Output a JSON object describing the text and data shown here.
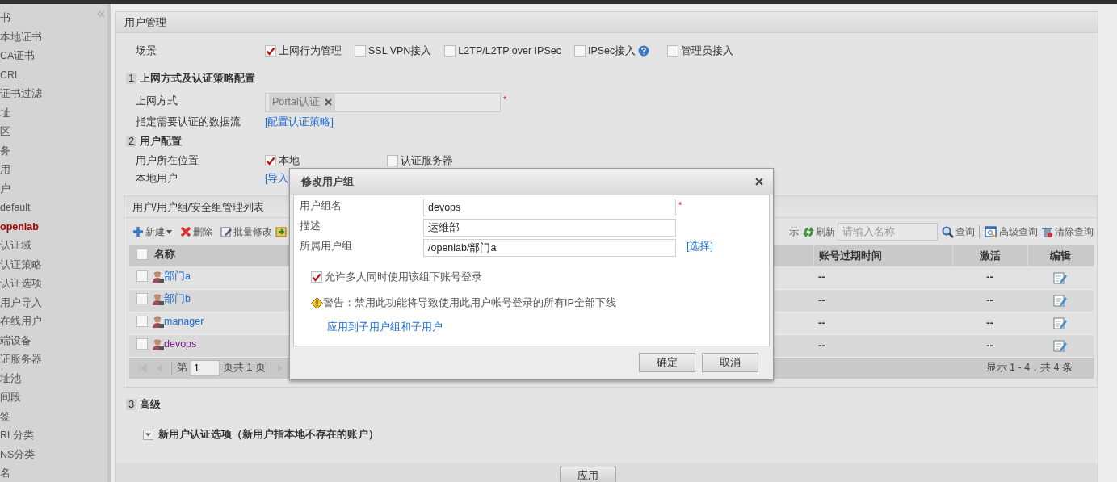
{
  "sidebar": {
    "items": [
      {
        "label": "书",
        "selected": false
      },
      {
        "label": "本地证书",
        "selected": false
      },
      {
        "label": "CA证书",
        "selected": false
      },
      {
        "label": "CRL",
        "selected": false
      },
      {
        "label": "证书过滤",
        "selected": false
      },
      {
        "label": "址",
        "selected": false
      },
      {
        "label": "区",
        "selected": false
      },
      {
        "label": "务",
        "selected": false
      },
      {
        "label": "用",
        "selected": false
      },
      {
        "label": "户",
        "selected": false
      },
      {
        "label": "default",
        "selected": false
      },
      {
        "label": "openlab",
        "selected": true
      },
      {
        "label": "认证域",
        "selected": false
      },
      {
        "label": "认证策略",
        "selected": false
      },
      {
        "label": "认证选项",
        "selected": false
      },
      {
        "label": "用户导入",
        "selected": false
      },
      {
        "label": "在线用户",
        "selected": false
      },
      {
        "label": "端设备",
        "selected": false
      },
      {
        "label": "证服务器",
        "selected": false
      },
      {
        "label": "址池",
        "selected": false
      },
      {
        "label": "间段",
        "selected": false
      },
      {
        "label": "签",
        "selected": false
      },
      {
        "label": "RL分类",
        "selected": false
      },
      {
        "label": "NS分类",
        "selected": false
      },
      {
        "label": "名",
        "selected": false
      }
    ]
  },
  "panel": {
    "title": "用户管理",
    "scene": {
      "label": "场景",
      "options": [
        {
          "label": "上网行为管理",
          "checked": true,
          "help": false
        },
        {
          "label": "SSL VPN接入",
          "checked": false,
          "help": false
        },
        {
          "label": "L2TP/L2TP over IPSec",
          "checked": false,
          "help": false
        },
        {
          "label": "IPSec接入",
          "checked": false,
          "help": true
        },
        {
          "label": "管理员接入",
          "checked": false,
          "help": false
        }
      ]
    },
    "section_1": {
      "number": "1",
      "title": "上网方式及认证策略配置",
      "access_mode": {
        "label": "上网方式",
        "tags": [
          "Portal认证"
        ],
        "required_mark": "*"
      },
      "data_flow": {
        "label": "指定需要认证的数据流",
        "link": "[配置认证策略]"
      }
    },
    "section_2": {
      "number": "2",
      "title": "用户配置",
      "location": {
        "label": "用户所在位置",
        "options": [
          {
            "label": "本地",
            "checked": true
          },
          {
            "label": "认证服务器",
            "checked": false
          }
        ]
      },
      "local_users": {
        "label": "本地用户",
        "link": "[导入"
      }
    },
    "user_list": {
      "title": "用户/用户组/安全组管理列表",
      "toolbar_left": [
        {
          "kind": "new",
          "label": "新建"
        },
        {
          "kind": "delete",
          "label": "删除"
        },
        {
          "kind": "batch",
          "label": "批量修改"
        },
        {
          "kind": "import"
        }
      ],
      "toolbar_right": {
        "partial_label": "示",
        "refresh": "刷新",
        "search_placeholder": "请输入名称",
        "query": "查询",
        "advanced": "高级查询",
        "clear": "清除查询"
      },
      "columns": {
        "select_all": false,
        "name": "名称",
        "expiry": "账号过期时间",
        "active": "激活",
        "edit": "编辑"
      },
      "rows": [
        {
          "checked": false,
          "name": "部门a",
          "visited": false,
          "expiry": "--",
          "active": "--"
        },
        {
          "checked": false,
          "name": "部门b",
          "visited": false,
          "expiry": "--",
          "active": "--"
        },
        {
          "checked": false,
          "name": "manager",
          "visited": false,
          "expiry": "--",
          "active": "--"
        },
        {
          "checked": false,
          "name": "devops",
          "visited": true,
          "expiry": "--",
          "active": "--"
        }
      ],
      "pager": {
        "page_label": "第",
        "page": "1",
        "total": "页共 1 页",
        "summary": "显示 1 - 4，共 4 条"
      }
    },
    "section_3": {
      "number": "3",
      "title": "高级",
      "option": "新用户认证选项（新用户指本地不存在的账户）"
    },
    "apply_button": "应用"
  },
  "dialog": {
    "title": "修改用户组",
    "fields": [
      {
        "label": "用户组名",
        "value": "devops",
        "required_mark": "*"
      },
      {
        "label": "描述",
        "value": "运维部"
      },
      {
        "label": "所属用户组",
        "value": "/openlab/部门a",
        "link": "[选择]"
      }
    ],
    "multi_login": {
      "label": "允许多人同时使用该组下账号登录",
      "checked": true
    },
    "warning": "警告：禁用此功能将导致使用此用户帐号登录的所有IP全部下线",
    "apply_link": "应用到子用户组和子用户",
    "buttons": [
      "确定",
      "取消"
    ]
  }
}
